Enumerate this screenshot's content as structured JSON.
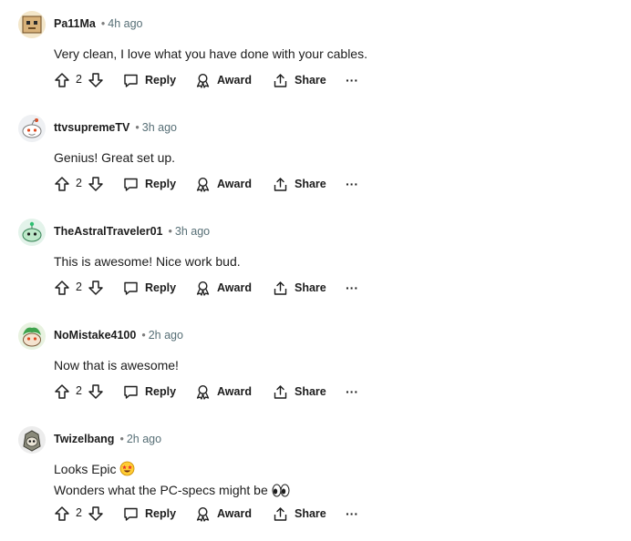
{
  "comments": [
    {
      "author": "Pa11Ma",
      "time": "4h ago",
      "lines": [
        "Very clean, I love what you have done with your cables."
      ],
      "votes": "2",
      "avatar": "avatar-box-character"
    },
    {
      "author": "ttvsupremeTV",
      "time": "3h ago",
      "lines": [
        "Genius! Great set up."
      ],
      "votes": "2",
      "avatar": "avatar-snoo-default"
    },
    {
      "author": "TheAstralTraveler01",
      "time": "3h ago",
      "lines": [
        "This is awesome! Nice work bud."
      ],
      "votes": "2",
      "avatar": "avatar-snoo-green"
    },
    {
      "author": "NoMistake4100",
      "time": "2h ago",
      "lines": [
        "Now that is awesome!"
      ],
      "votes": "2",
      "avatar": "avatar-snoo-green-hair"
    },
    {
      "author": "Twizelbang",
      "time": "2h ago",
      "lines": [
        "Looks Epic",
        "Wonders what the PC-specs might be"
      ],
      "votes": "2",
      "avatar": "avatar-snoo-armor"
    }
  ],
  "actions": {
    "reply": "Reply",
    "award": "Award",
    "share": "Share",
    "more": "···"
  },
  "separator": "•",
  "emoji": {
    "line1": "star-struck-emoji",
    "line2": "eyes-emoji"
  }
}
